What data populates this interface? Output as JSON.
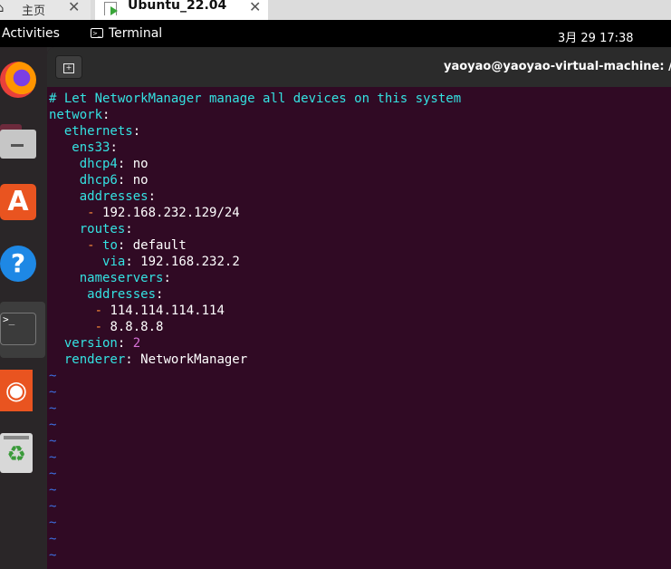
{
  "host_tabs": {
    "home_label": "主页",
    "vm_label": "Ubuntu_22.04",
    "close_glyph": "✕"
  },
  "top_bar": {
    "activities": "Activities",
    "app_name": "Terminal",
    "clock": "3月 29  17:38"
  },
  "dock": {
    "items": [
      "firefox-icon",
      "files-icon",
      "app-center-icon",
      "help-icon",
      "terminal-icon",
      "ubuntu-icon",
      "trash-icon"
    ],
    "terminal_glyph": ">_"
  },
  "terminal": {
    "window_title": "yaoyao@yaoyao-virtual-machine: /e",
    "lines": [
      {
        "indent": "",
        "comment": "# Let NetworkManager manage all devices on this system"
      },
      {
        "indent": "",
        "key": "network",
        "sep": ":"
      },
      {
        "indent": "  ",
        "key": "ethernets",
        "sep": ":"
      },
      {
        "indent": "   ",
        "key": "ens33",
        "sep": ":"
      },
      {
        "indent": "    ",
        "key": "dhcp4",
        "sep": ":",
        "value": " no"
      },
      {
        "indent": "    ",
        "key": "dhcp6",
        "sep": ":",
        "value": " no"
      },
      {
        "indent": "    ",
        "key": "addresses",
        "sep": ":"
      },
      {
        "indent": "     ",
        "dash": "-",
        "value": " 192.168.232.129/24"
      },
      {
        "indent": "    ",
        "key": "routes",
        "sep": ":"
      },
      {
        "indent": "     ",
        "dash": "-",
        "key": " to",
        "sep": ":",
        "value": " default"
      },
      {
        "indent": "       ",
        "key": "via",
        "sep": ":",
        "value": " 192.168.232.2"
      },
      {
        "indent": "    ",
        "key": "nameservers",
        "sep": ":"
      },
      {
        "indent": "     ",
        "key": "addresses",
        "sep": ":"
      },
      {
        "indent": "      ",
        "dash": "-",
        "value": " 114.114.114.114"
      },
      {
        "indent": "      ",
        "dash": "-",
        "value": " 8.8.8.8"
      },
      {
        "indent": "  ",
        "key": "version",
        "sep": ":",
        "number": " 2"
      },
      {
        "indent": "  ",
        "key": "renderer",
        "sep": ":",
        "value": " NetworkManager"
      }
    ],
    "empty_line_marker": "~",
    "empty_line_count": 12
  },
  "colors": {
    "terminal_bg": "#300a24",
    "key": "#34e2e2",
    "number": "#d670d6",
    "dash": "#ff8c3a",
    "tilde": "#3d6fe0"
  }
}
